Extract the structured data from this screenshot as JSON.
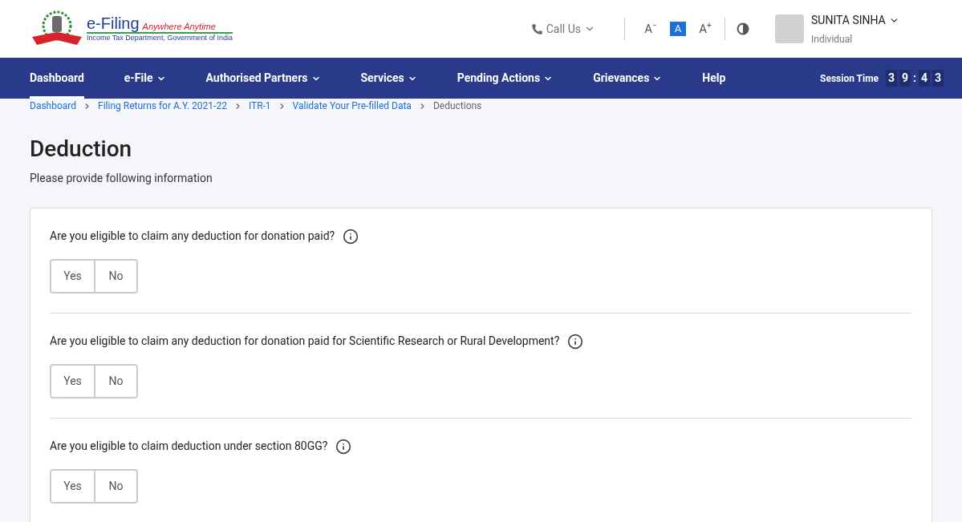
{
  "logo": {
    "title": "e-Filing",
    "tagline": "Anywhere Anytime",
    "subtitle": "Income Tax Department, Government of India"
  },
  "header": {
    "call_us": "Call Us",
    "font_sizes": [
      {
        "label": "A",
        "mark": "−",
        "selected": false
      },
      {
        "label": "A",
        "selected": true
      },
      {
        "label": "A",
        "mark": "+",
        "selected": false
      }
    ],
    "user": {
      "name": "SUNITA SINHA",
      "role": "Individual"
    }
  },
  "nav": {
    "items": [
      {
        "label": "Dashboard",
        "dropdown": false,
        "selected": true
      },
      {
        "label": "e-File",
        "dropdown": true,
        "selected": false
      },
      {
        "label": "Authorised Partners",
        "dropdown": true,
        "selected": false
      },
      {
        "label": "Services",
        "dropdown": true,
        "selected": false
      },
      {
        "label": "Pending Actions",
        "dropdown": true,
        "selected": false
      },
      {
        "label": "Grievances",
        "dropdown": true,
        "selected": false
      },
      {
        "label": "Help",
        "dropdown": false,
        "selected": false
      }
    ],
    "session_label": "Session Time",
    "session_digits": [
      "3",
      "9",
      ":",
      "4",
      "3"
    ]
  },
  "breadcrumb": [
    {
      "label": "Dashboard",
      "current": false
    },
    {
      "label": "Filing Returns for A.Y. 2021-22",
      "current": false
    },
    {
      "label": "ITR-1",
      "current": false
    },
    {
      "label": "Validate Your Pre-filled Data",
      "current": false
    },
    {
      "label": "Deductions",
      "current": true
    }
  ],
  "page": {
    "title": "Deduction",
    "subtitle": "Please provide following information"
  },
  "questions": [
    {
      "text": "Are you eligible to claim any deduction for donation paid?",
      "options": [
        {
          "label": "Yes",
          "selected": false
        },
        {
          "label": "No",
          "selected": false
        }
      ]
    },
    {
      "text": "Are you eligible to claim any deduction for donation paid for Scientific Research or Rural Development?",
      "options": [
        {
          "label": "Yes",
          "selected": false
        },
        {
          "label": "No",
          "selected": false
        }
      ]
    },
    {
      "text": "Are you eligible to claim deduction under section 80GG?",
      "options": [
        {
          "label": "Yes",
          "selected": false
        },
        {
          "label": "No",
          "selected": false
        }
      ]
    }
  ]
}
